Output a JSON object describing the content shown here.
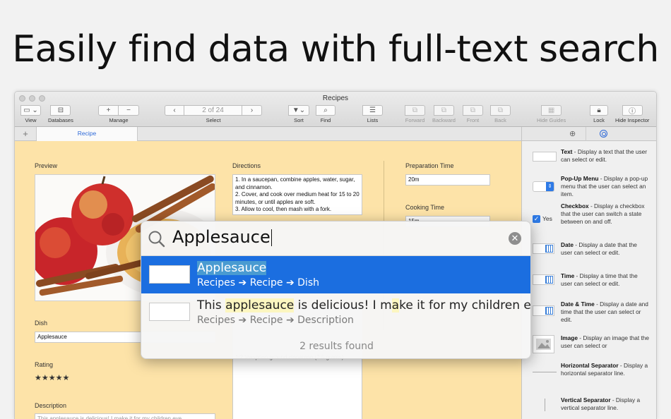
{
  "headline": "Easily find data with full-text search",
  "window": {
    "title": "Recipes",
    "toolbar": {
      "view_label": "View",
      "databases_label": "Databases",
      "manage_label": "Manage",
      "nav_counter": "2 of 24",
      "select_label": "Select",
      "sort_label": "Sort",
      "find_label": "Find",
      "lists_label": "Lists",
      "forward_label": "Forward",
      "backward_label": "Backward",
      "front_label": "Front",
      "back_label": "Back",
      "hide_guides_label": "Hide Guides",
      "lock_label": "Lock",
      "hide_inspector_label": "Hide Inspector"
    },
    "tab_add": "+",
    "tab_label": "Recipe"
  },
  "form": {
    "preview_label": "Preview",
    "directions_label": "Directions",
    "directions_text": "1. In a saucepan, combine apples, water, sugar, and cinnamon.\n2. Cover, and cook over medium heat for 15 to 20 minutes, or until apples are soft.\n3. Allow to cool, then mash with a fork.",
    "prep_label": "Preparation Time",
    "prep_value": "20m",
    "cook_label": "Cooking Time",
    "cook_value": "15m",
    "dish_label": "Dish",
    "dish_value": "Applesauce",
    "rating_label": "Rating",
    "rating_stars": "★★★★★",
    "description_label": "Description",
    "description_value": "This applesauce is delicious! I make it for my children eve",
    "ingredients_peek": "1/2 teaspoon ground cinnamon (2.5 grams)"
  },
  "inspector": {
    "items": [
      {
        "title": "Text",
        "desc": " - Display a text that the user can select or edit."
      },
      {
        "title": "Pop-Up Menu",
        "desc": " - Display a pop-up menu that the user can select an item."
      },
      {
        "title": "Checkbox",
        "desc": " - Display a checkbox that the user can switch a state between on and off.",
        "extra": "Yes"
      },
      {
        "title": "Date",
        "desc": " - Display a date that the user can select or edit."
      },
      {
        "title": "Time",
        "desc": " - Display a time that the user can select or edit."
      },
      {
        "title": "Date & Time",
        "desc": " - Display a date and time that the user can select or edit."
      },
      {
        "title": "Image",
        "desc": " - Display an image that the user can select or"
      },
      {
        "title": "Horizontal Separator",
        "desc": " - Display a horizontal separator line."
      },
      {
        "title": "Vertical Separator",
        "desc": " - Display a vertical separator line."
      }
    ]
  },
  "search": {
    "query": "Applesauce",
    "results": [
      {
        "title": "Applesauce",
        "path": "Recipes ➔ Recipe ➔ Dish"
      },
      {
        "title": "This applesauce is delicious! I make it for my children eve...",
        "path": "Recipes ➔ Recipe ➔ Description"
      }
    ],
    "summary": "2 results found"
  }
}
